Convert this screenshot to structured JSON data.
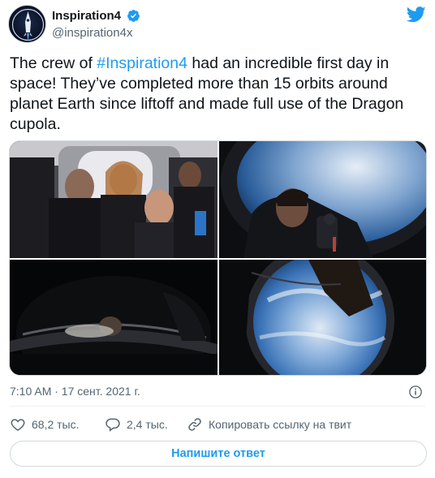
{
  "author": {
    "name": "Inspiration4",
    "handle": "@inspiration4x",
    "avatar_icon": "rocket-icon",
    "verified_icon": "verified-badge-icon"
  },
  "brand_icon": "twitter-bird-icon",
  "tweet": {
    "text_before": "The crew of ",
    "hashtag": "#Inspiration4",
    "text_after": " had an incredible first day in space! They’ve completed more than 15 orbits around planet Earth since liftoff and made full use of the Dragon cupola."
  },
  "media": {
    "count": 4
  },
  "meta": {
    "timestamp": "7:10 AM · 17 сент. 2021 г.",
    "info_icon": "info-icon"
  },
  "actions": {
    "like_count": "68,2 тыс.",
    "reply_count": "2,4 тыс.",
    "copy_link_label": "Копировать ссылку на твит"
  },
  "reply_button": {
    "label": "Напишите ответ"
  },
  "colors": {
    "accent": "#1d9bf0",
    "text": "#0f1419",
    "secondary": "#536471",
    "border": "#cfd9de"
  }
}
